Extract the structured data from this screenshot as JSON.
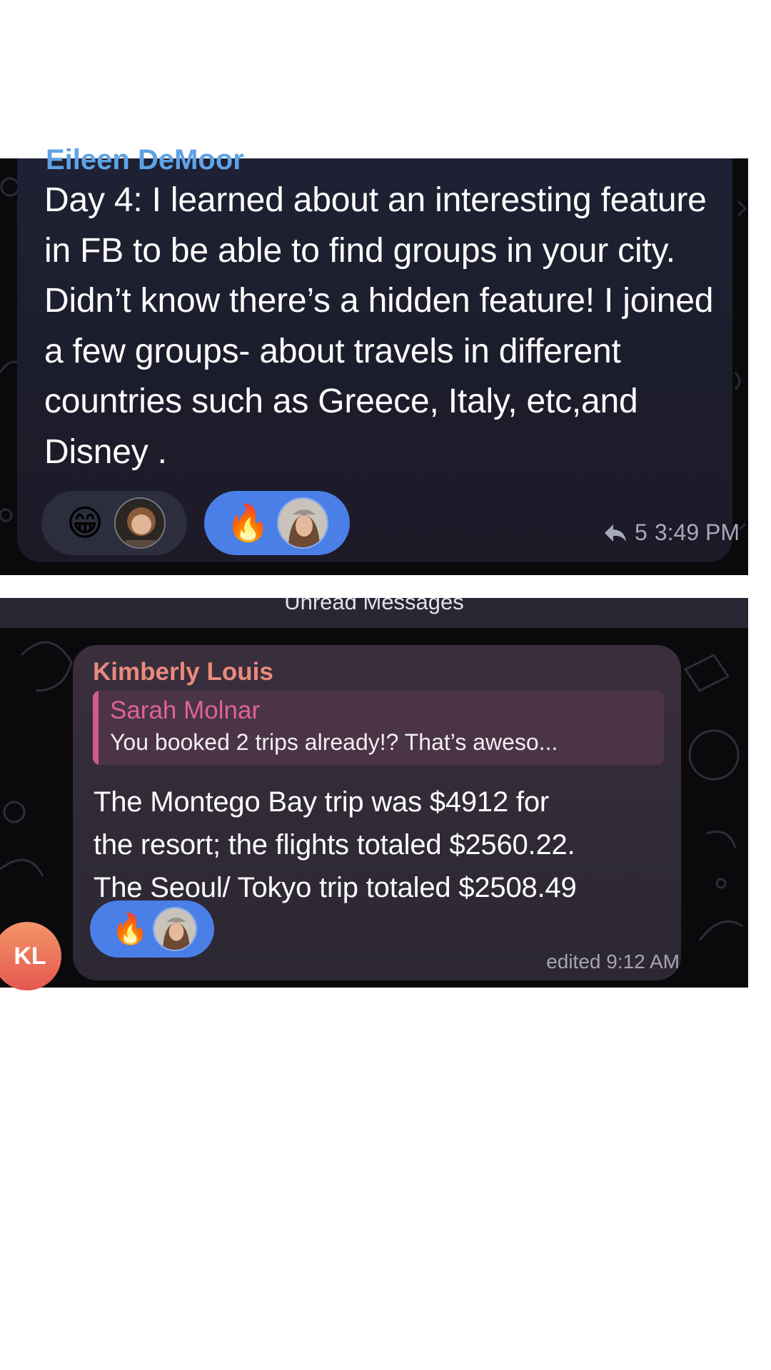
{
  "message1": {
    "sender_cut": "Eileen DeMoor",
    "text": "Day 4: I learned about an interesting feature in FB to be able to find groups in your city. Didn’t know there’s a hidden feature! I joined a few groups- about travels in different countries such as Greece, Italy, etc,and Disney .",
    "reactions": [
      {
        "emoji": "😁",
        "style": "grey"
      },
      {
        "emoji": "🔥",
        "style": "blue"
      }
    ],
    "reply_count": "5",
    "time": "3:49 PM"
  },
  "divider": {
    "label": "Unread Messages"
  },
  "message2": {
    "sender": "Kimberly Louis",
    "reply": {
      "name": "Sarah Molnar",
      "snippet": "You booked 2 trips already!? That’s aweso..."
    },
    "lines": [
      "The Montego Bay trip was $4912 for",
      "the resort; the flights totaled $2560.22.",
      "The Seoul/ Tokyo trip totaled $2508.49"
    ],
    "reactions": [
      {
        "emoji": "🔥",
        "style": "blue"
      }
    ],
    "edited_time": "edited 9:12 AM",
    "avatar_initials": "KL"
  },
  "colors": {
    "sender1": "#5fa3e6",
    "sender2": "#e98a7c",
    "reply_accent": "#d25890",
    "reaction_blue": "#4a7fe7",
    "avatar_gradient_top": "#f49569",
    "avatar_gradient_bottom": "#e4584f"
  },
  "icons": {
    "reply": "reply-arrow-icon"
  }
}
